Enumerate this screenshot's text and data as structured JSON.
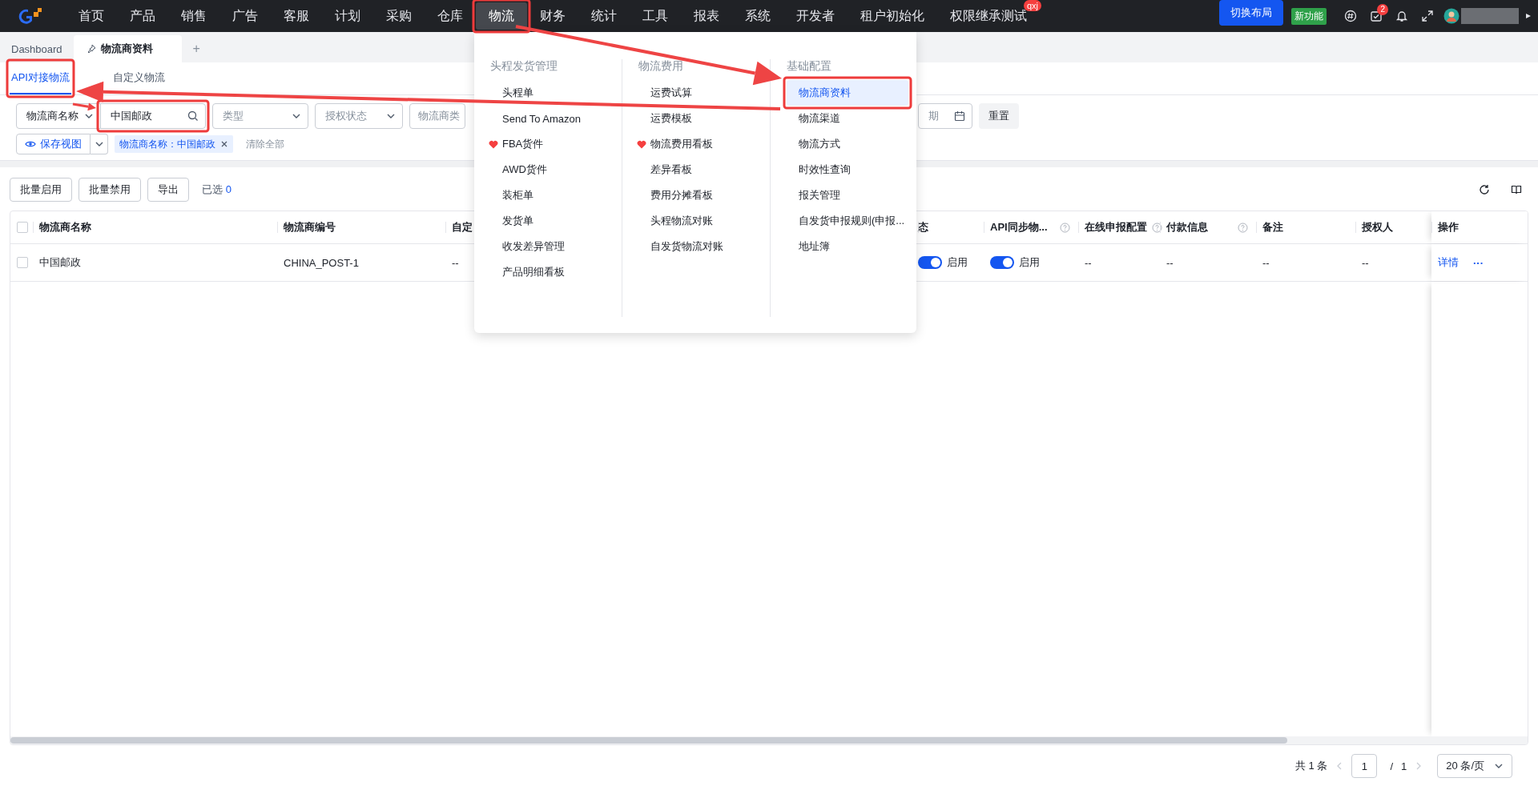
{
  "topbar": {
    "nav": [
      {
        "label": "首页",
        "selected": false
      },
      {
        "label": "产品",
        "selected": false
      },
      {
        "label": "销售",
        "selected": false
      },
      {
        "label": "广告",
        "selected": false
      },
      {
        "label": "客服",
        "selected": false
      },
      {
        "label": "计划",
        "selected": false
      },
      {
        "label": "采购",
        "selected": false
      },
      {
        "label": "仓库",
        "selected": false
      },
      {
        "label": "物流",
        "selected": true
      },
      {
        "label": "财务",
        "selected": false
      },
      {
        "label": "统计",
        "selected": false
      },
      {
        "label": "工具",
        "selected": false
      },
      {
        "label": "报表",
        "selected": false
      },
      {
        "label": "系统",
        "selected": false
      },
      {
        "label": "开发者",
        "selected": false
      },
      {
        "label": "租户初始化",
        "selected": false
      },
      {
        "label": "权限继承测试",
        "selected": false,
        "badge": "qxj"
      }
    ],
    "layout_button": "切换布局",
    "new_feature": "新功能",
    "task_count": "2"
  },
  "page_tabs": [
    {
      "label": "Dashboard",
      "selected": false,
      "pinned": false
    },
    {
      "label": "物流商资料",
      "selected": true,
      "pinned": true
    }
  ],
  "add_tab": "+",
  "sub_tabs": [
    {
      "label": "API对接物流",
      "selected": true
    },
    {
      "label": "自定义物流",
      "selected": false
    }
  ],
  "filters": {
    "fields": [
      {
        "kind": "select",
        "value": "物流商名称"
      },
      {
        "kind": "search",
        "value": "中国邮政"
      },
      {
        "kind": "select",
        "placeholder": "类型"
      },
      {
        "kind": "select",
        "placeholder": "授权状态"
      },
      {
        "kind": "input",
        "placeholder": "物流商类"
      },
      {
        "kind": "date",
        "placeholder": "期"
      }
    ],
    "reset": "重置",
    "save_view": "保存视图",
    "tags": [
      {
        "label": "物流商名称：中国邮政"
      }
    ],
    "clear_all": "清除全部"
  },
  "toolbar": {
    "buttons": [
      "批量启用",
      "批量禁用",
      "导出"
    ],
    "selected_label": "已选",
    "selected_count": "0"
  },
  "table": {
    "all_selected": false,
    "columns": [
      {
        "label": "物流商名称"
      },
      {
        "label": "物流商编号"
      },
      {
        "label": "自定"
      },
      {
        "label": "态"
      },
      {
        "label": "API同步物...",
        "help": true
      },
      {
        "label": "在线申报配置",
        "help": true
      },
      {
        "label": "付款信息",
        "help": true
      },
      {
        "label": "备注"
      },
      {
        "label": "授权人"
      },
      {
        "label": "操作"
      }
    ],
    "rows": [
      {
        "selected": false,
        "cells": [
          {
            "kind": "text",
            "text": "中国邮政"
          },
          {
            "kind": "text",
            "text": "CHINA_POST-1"
          },
          {
            "kind": "text",
            "text": "--"
          },
          {
            "kind": "switch",
            "on": true,
            "label": "启用"
          },
          {
            "kind": "switch",
            "on": true,
            "label": "启用"
          },
          {
            "kind": "text",
            "text": "--"
          },
          {
            "kind": "text",
            "text": "--"
          },
          {
            "kind": "text",
            "text": "--"
          },
          {
            "kind": "text",
            "text": "--"
          },
          {
            "kind": "actions",
            "link": "详情",
            "more": "···"
          }
        ]
      }
    ]
  },
  "pagination": {
    "total": "共 1 条",
    "page": "1",
    "separator": "/",
    "page_count": "1",
    "page_size": "20 条/页"
  },
  "menu": {
    "columns": [
      {
        "title": "头程发货管理",
        "items": [
          {
            "label": "头程单",
            "favorite": false,
            "selected": false
          },
          {
            "label": "Send To Amazon",
            "favorite": false,
            "selected": false
          },
          {
            "label": "FBA货件",
            "favorite": true,
            "selected": false
          },
          {
            "label": "AWD货件",
            "favorite": false,
            "selected": false
          },
          {
            "label": "装柜单",
            "favorite": false,
            "selected": false
          },
          {
            "label": "发货单",
            "favorite": false,
            "selected": false
          },
          {
            "label": "收发差异管理",
            "favorite": false,
            "selected": false
          },
          {
            "label": "产品明细看板",
            "favorite": false,
            "selected": false
          }
        ]
      },
      {
        "title": "物流费用",
        "items": [
          {
            "label": "运费试算",
            "favorite": false,
            "selected": false
          },
          {
            "label": "运费模板",
            "favorite": false,
            "selected": false
          },
          {
            "label": "物流费用看板",
            "favorite": true,
            "selected": false
          },
          {
            "label": "差异看板",
            "favorite": false,
            "selected": false
          },
          {
            "label": "费用分摊看板",
            "favorite": false,
            "selected": false
          },
          {
            "label": "头程物流对账",
            "favorite": false,
            "selected": false
          },
          {
            "label": "自发货物流对账",
            "favorite": false,
            "selected": false
          }
        ]
      },
      {
        "title": "基础配置",
        "items": [
          {
            "label": "物流商资料",
            "favorite": false,
            "selected": true
          },
          {
            "label": "物流渠道",
            "favorite": false,
            "selected": false
          },
          {
            "label": "物流方式",
            "favorite": false,
            "selected": false
          },
          {
            "label": "时效性查询",
            "favorite": false,
            "selected": false
          },
          {
            "label": "报关管理",
            "favorite": false,
            "selected": false
          },
          {
            "label": "自发货申报规则(申报...",
            "favorite": false,
            "selected": false
          },
          {
            "label": "地址簿",
            "favorite": false,
            "selected": false
          }
        ]
      }
    ]
  }
}
